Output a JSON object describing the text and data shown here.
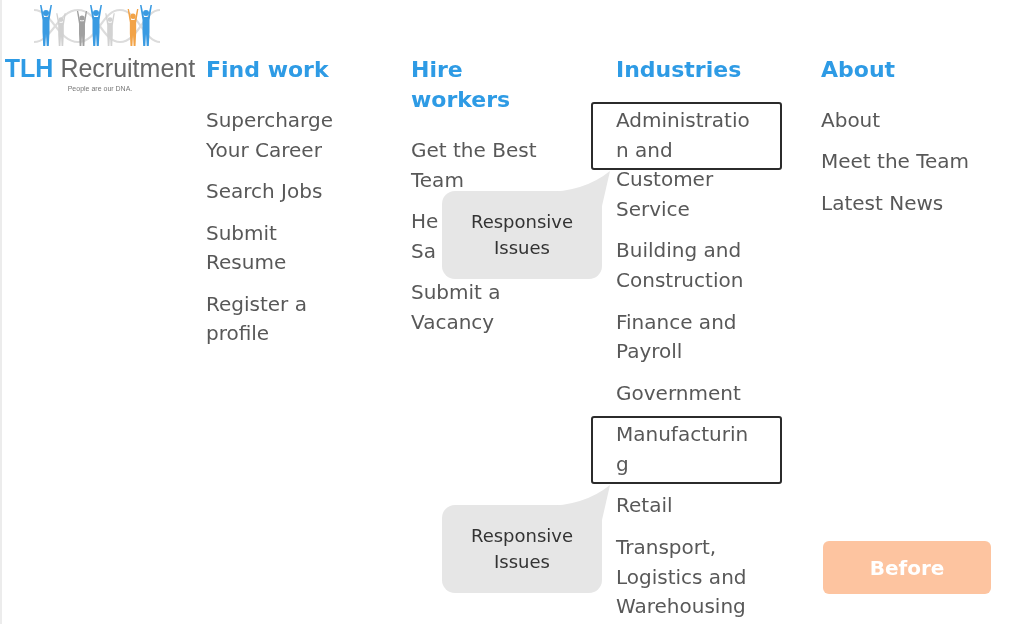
{
  "logo": {
    "name": "**TLH** Recruitment",
    "tagline": "People are our DNA."
  },
  "columns": [
    {
      "heading": [
        "Find work"
      ],
      "items": [
        {
          "lines": [
            {
              "text": "Supercharge",
              "framed": false
            },
            {
              "text": "Your Career",
              "framed": false
            }
          ]
        },
        {
          "lines": [
            {
              "text": "Search Jobs",
              "framed": false
            }
          ]
        },
        {
          "lines": [
            {
              "text": "Submit",
              "framed": false
            },
            {
              "text": "Resume",
              "framed": false
            }
          ]
        },
        {
          "lines": [
            {
              "text": "Register a",
              "framed": false
            },
            {
              "text": "profile",
              "framed": false
            }
          ]
        }
      ]
    },
    {
      "heading": [
        "Hire",
        "workers"
      ],
      "items": [
        {
          "lines": [
            {
              "text": "Get the Best",
              "framed": false
            },
            {
              "text": "Team",
              "framed": false
            }
          ]
        },
        {
          "lines": [
            {
              "text": "He",
              "framed": false
            },
            {
              "text": "Sa",
              "framed": false
            }
          ]
        },
        {
          "lines": [
            {
              "text": "Submit a",
              "framed": false
            },
            {
              "text": "Vacancy",
              "framed": false
            }
          ]
        }
      ]
    },
    {
      "heading": [
        "Industries"
      ],
      "items": [
        {
          "lines": [
            {
              "text": "Administratio",
              "framed": true
            },
            {
              "text": "n and",
              "framed": true
            },
            {
              "text": "Customer",
              "framed": false
            },
            {
              "text": "Service",
              "framed": false
            }
          ],
          "callout": "Responsive Issues"
        },
        {
          "lines": [
            {
              "text": "Building and",
              "framed": false
            },
            {
              "text": "Construction",
              "framed": false
            }
          ]
        },
        {
          "lines": [
            {
              "text": "Finance and",
              "framed": false
            },
            {
              "text": "Payroll",
              "framed": false
            }
          ]
        },
        {
          "lines": [
            {
              "text": "Government",
              "framed": false
            }
          ]
        },
        {
          "lines": [
            {
              "text": "Manufacturin",
              "framed": true
            },
            {
              "text": "g",
              "framed": true
            }
          ],
          "callout": "Responsive Issues"
        },
        {
          "lines": [
            {
              "text": "Retail",
              "framed": false
            }
          ]
        },
        {
          "lines": [
            {
              "text": "Transport,",
              "framed": false
            },
            {
              "text": "Logistics and",
              "framed": false
            },
            {
              "text": "Warehousing",
              "framed": false
            }
          ]
        }
      ]
    },
    {
      "heading": [
        "About"
      ],
      "items": [
        {
          "lines": [
            {
              "text": "About",
              "framed": false
            }
          ]
        },
        {
          "lines": [
            {
              "text": "Meet the Team",
              "framed": false
            }
          ]
        },
        {
          "lines": [
            {
              "text": "Latest News",
              "framed": false
            }
          ]
        }
      ]
    }
  ],
  "tag": {
    "text": "Before"
  }
}
